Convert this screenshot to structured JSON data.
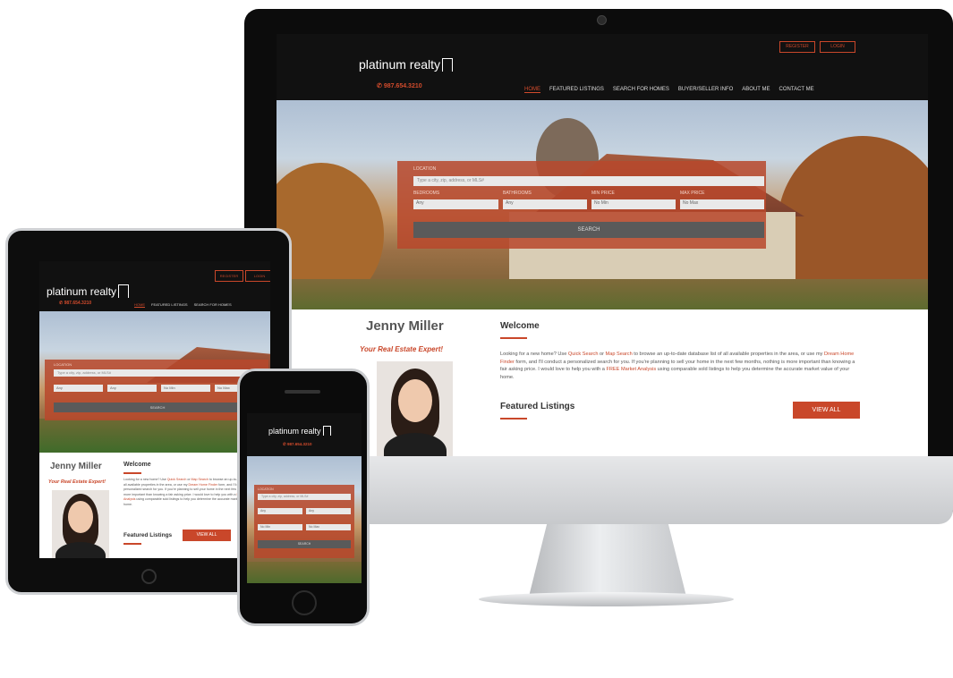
{
  "brand": {
    "logo": "platinum realty",
    "phone": "987.654.3210",
    "accent": "#c9472a"
  },
  "top_buttons": [
    "REGISTER",
    "LOGIN"
  ],
  "nav": [
    "HOME",
    "FEATURED LISTINGS",
    "SEARCH FOR HOMES",
    "BUYER/SELLER INFO",
    "ABOUT ME",
    "CONTACT ME"
  ],
  "search": {
    "location_label": "LOCATION",
    "location_placeholder": "Type a city, zip, address, or MLS#",
    "bedrooms_label": "BEDROOMS",
    "bathrooms_label": "BATHROOMS",
    "min_price_label": "MIN PRICE",
    "max_price_label": "MAX PRICE",
    "bedrooms_value": "Any",
    "bathrooms_value": "Any",
    "min_price_value": "No Min",
    "max_price_value": "No Max",
    "button": "SEARCH"
  },
  "agent": {
    "name": "Jenny Miller",
    "tagline": "Your Real Estate Expert!"
  },
  "welcome": {
    "title": "Welcome",
    "p1": "Looking for a new home? Use ",
    "link1": "Quick Search",
    "p2": " or ",
    "link2": "Map Search",
    "p3": " to browse an up-to-date database list of all available properties in the area, or use my ",
    "link3": "Dream Home Finder",
    "p4": " form, and I'll conduct a personalized search for you. If you're planning to sell your home in the next few months, nothing is more important than knowing a fair asking price. I would love to help you with a ",
    "link4": "FREE Market Analysis",
    "p5": " using comparable sold listings to help you determine the accurate market value of your home."
  },
  "featured": {
    "title": "Featured Listings",
    "button": "VIEW ALL"
  }
}
